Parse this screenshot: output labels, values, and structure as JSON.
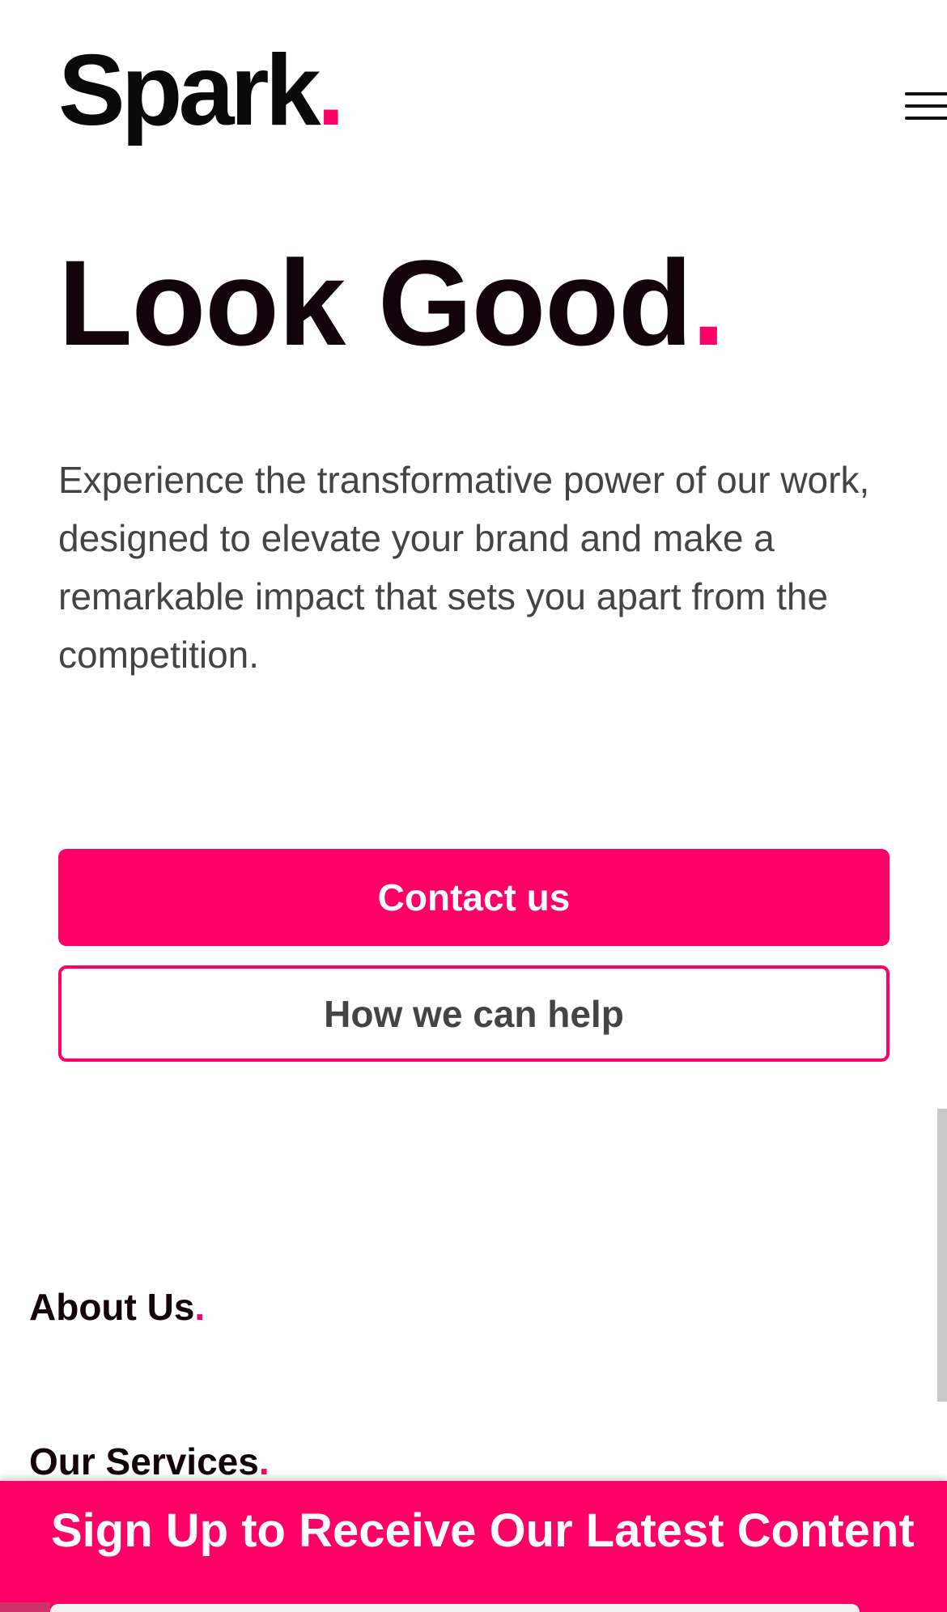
{
  "header": {
    "logo_text": "Spark",
    "logo_dot": ".",
    "menu_icon": "hamburger-menu-icon"
  },
  "hero": {
    "title": "Look Good",
    "title_dot": ".",
    "description": "Experience the transformative power of our work, designed to elevate your brand and make a remarkable impact that sets you apart from the competition.",
    "primary_button_label": "Contact us",
    "secondary_button_label": "How we can help"
  },
  "sections": {
    "about_label": "About Us",
    "about_dot": ".",
    "services_label": "Our Services",
    "services_dot": "."
  },
  "signup": {
    "title": "Sign Up to Receive Our Latest Content"
  },
  "colors": {
    "accent": "#ff0066",
    "heading": "#12040a",
    "body_text": "#444444",
    "background": "#ffffff"
  }
}
